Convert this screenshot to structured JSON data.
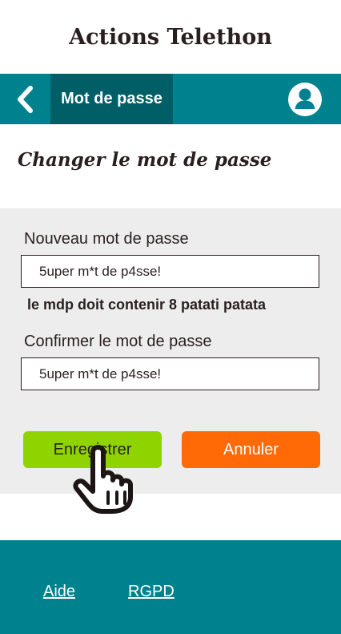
{
  "app": {
    "title": "Actions Telethon"
  },
  "navbar": {
    "back_icon": "chevron-left-icon",
    "active_tab": "Mot de passe",
    "profile_icon": "user-account-icon"
  },
  "page": {
    "heading": "Changer le mot de passe"
  },
  "form": {
    "new_password": {
      "label": "Nouveau mot de passe",
      "value": "5uper m*t de p4sse!"
    },
    "hint": "le mdp doit contenir 8 patati patata",
    "confirm_password": {
      "label": "Confirmer  le mot de passe",
      "value": "5uper m*t de p4sse!"
    },
    "save_label": "Enregistrer",
    "cancel_label": "Annuler"
  },
  "footer": {
    "help_link": "Aide",
    "rgpd_link": "RGPD"
  },
  "colors": {
    "teal": "#00828e",
    "teal_dark": "#005f66",
    "green": "#8fd400",
    "orange": "#ff6a06",
    "text": "#2a1f1f",
    "panel": "#ededed"
  }
}
